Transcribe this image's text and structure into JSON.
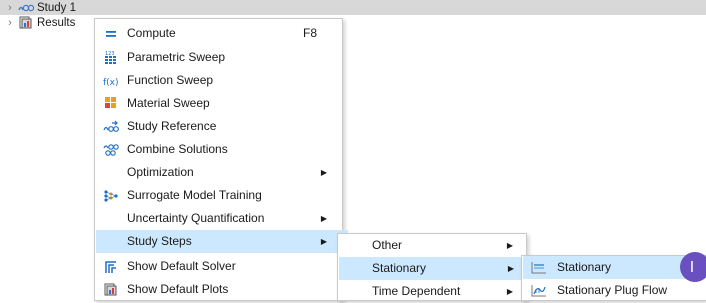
{
  "tree": {
    "study_label": "Study 1",
    "results_label": "Results"
  },
  "menu_main": {
    "items": [
      {
        "label": "Compute",
        "shortcut": "F8",
        "icon": "equals-icon"
      },
      {
        "label": "Parametric Sweep",
        "icon": "parametric-sweep-icon"
      },
      {
        "label": "Function Sweep",
        "icon": "function-sweep-icon"
      },
      {
        "label": "Material Sweep",
        "icon": "material-sweep-icon"
      },
      {
        "label": "Study Reference",
        "icon": "study-reference-icon"
      },
      {
        "label": "Combine Solutions",
        "icon": "combine-solutions-icon"
      },
      {
        "label": "Optimization",
        "submenu": true
      },
      {
        "label": "Surrogate Model Training",
        "icon": "surrogate-model-icon"
      },
      {
        "label": "Uncertainty Quantification",
        "submenu": true
      },
      {
        "label": "Study Steps",
        "submenu": true,
        "highlighted": true
      },
      {
        "label": "Show Default Solver",
        "icon": "solver-icon"
      },
      {
        "label": "Show Default Plots",
        "icon": "plots-icon"
      }
    ]
  },
  "menu_study_steps": {
    "items": [
      {
        "label": "Other",
        "submenu": true
      },
      {
        "label": "Stationary",
        "submenu": true,
        "highlighted": true
      },
      {
        "label": "Time Dependent",
        "submenu": true
      }
    ]
  },
  "menu_stationary": {
    "items": [
      {
        "label": "Stationary",
        "icon": "stationary-icon",
        "highlighted": true
      },
      {
        "label": "Stationary Plug Flow",
        "icon": "stationary-plug-flow-icon"
      }
    ]
  },
  "cursor_letter": "I",
  "colors": {
    "highlight": "#cce8ff",
    "tree_selection": "#d8d8d8",
    "accent_blue": "#1e6fc8",
    "badge": "#6a4fc0"
  }
}
